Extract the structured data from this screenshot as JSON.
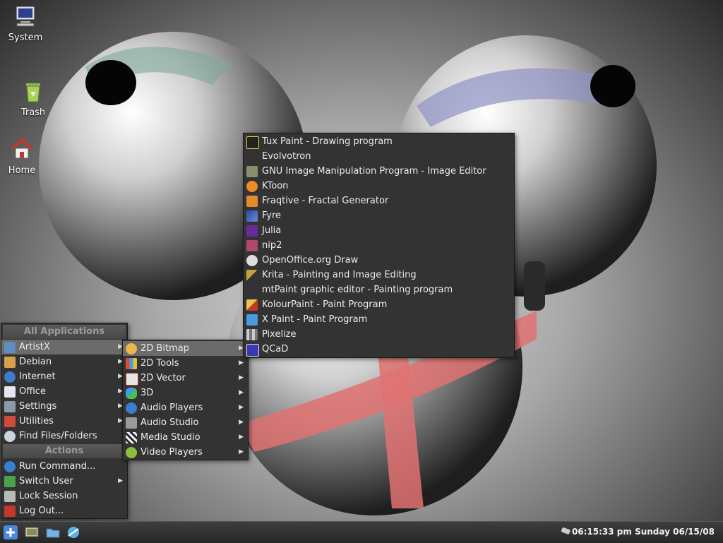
{
  "desktop": {
    "icons": [
      {
        "label": "System"
      },
      {
        "label": "Trash"
      },
      {
        "label": "Home"
      }
    ]
  },
  "main_menu": {
    "header_apps": "All Applications",
    "header_actions": "Actions",
    "items": [
      {
        "label": "ArtistX",
        "icon": "artistx-icon"
      },
      {
        "label": "Debian",
        "icon": "debian-icon"
      },
      {
        "label": "Internet",
        "icon": "globe-icon"
      },
      {
        "label": "Office",
        "icon": "document-icon"
      },
      {
        "label": "Settings",
        "icon": "tools-icon"
      },
      {
        "label": "Utilities",
        "icon": "utilities-icon"
      },
      {
        "label": "Find Files/Folders",
        "icon": "search-icon"
      }
    ],
    "actions": [
      {
        "label": "Run Command...",
        "icon": "gear-icon"
      },
      {
        "label": "Switch User",
        "icon": "user-icon"
      },
      {
        "label": "Lock Session",
        "icon": "lock-icon"
      },
      {
        "label": "Log Out...",
        "icon": "logout-icon"
      }
    ]
  },
  "sub_menu": {
    "items": [
      {
        "label": "2D Bitmap",
        "icon": "palette-icon"
      },
      {
        "label": "2D Tools",
        "icon": "grid-icon"
      },
      {
        "label": "2D Vector",
        "icon": "vector-icon"
      },
      {
        "label": "3D",
        "icon": "cubes-icon"
      },
      {
        "label": "Audio Players",
        "icon": "audio-player-icon"
      },
      {
        "label": "Audio Studio",
        "icon": "studio-icon"
      },
      {
        "label": "Media Studio",
        "icon": "clapper-icon"
      },
      {
        "label": "Video Players",
        "icon": "video-icon"
      }
    ]
  },
  "apps_menu": {
    "items": [
      {
        "label": "Tux Paint - Drawing program",
        "icon": "tux-icon"
      },
      {
        "label": "Evolvotron",
        "icon": ""
      },
      {
        "label": "GNU Image Manipulation Program - Image Editor",
        "icon": "gimp-icon"
      },
      {
        "label": "KToon",
        "icon": "ktoon-icon"
      },
      {
        "label": "Fraqtive - Fractal Generator",
        "icon": "fraqtive-icon"
      },
      {
        "label": "Fyre",
        "icon": "fyre-icon"
      },
      {
        "label": "Julia",
        "icon": "julia-icon"
      },
      {
        "label": "nip2",
        "icon": "nip2-icon"
      },
      {
        "label": "OpenOffice.org Draw",
        "icon": "draw-icon"
      },
      {
        "label": "Krita - Painting and Image Editing",
        "icon": "krita-icon"
      },
      {
        "label": "mtPaint graphic editor - Painting program",
        "icon": ""
      },
      {
        "label": "KolourPaint - Paint Program",
        "icon": "brush-icon"
      },
      {
        "label": "X Paint - Paint Program",
        "icon": "xpaint-icon"
      },
      {
        "label": "Pixelize",
        "icon": "pixelize-icon"
      },
      {
        "label": "QCaD",
        "icon": "qcad-icon"
      }
    ]
  },
  "taskbar": {
    "clock": "06:15:33 pm Sunday 06/15/08"
  },
  "colors": {
    "menu_bg": "#333333",
    "menu_selected": "#6b6b6b",
    "header_text": "#9a9a9a"
  }
}
